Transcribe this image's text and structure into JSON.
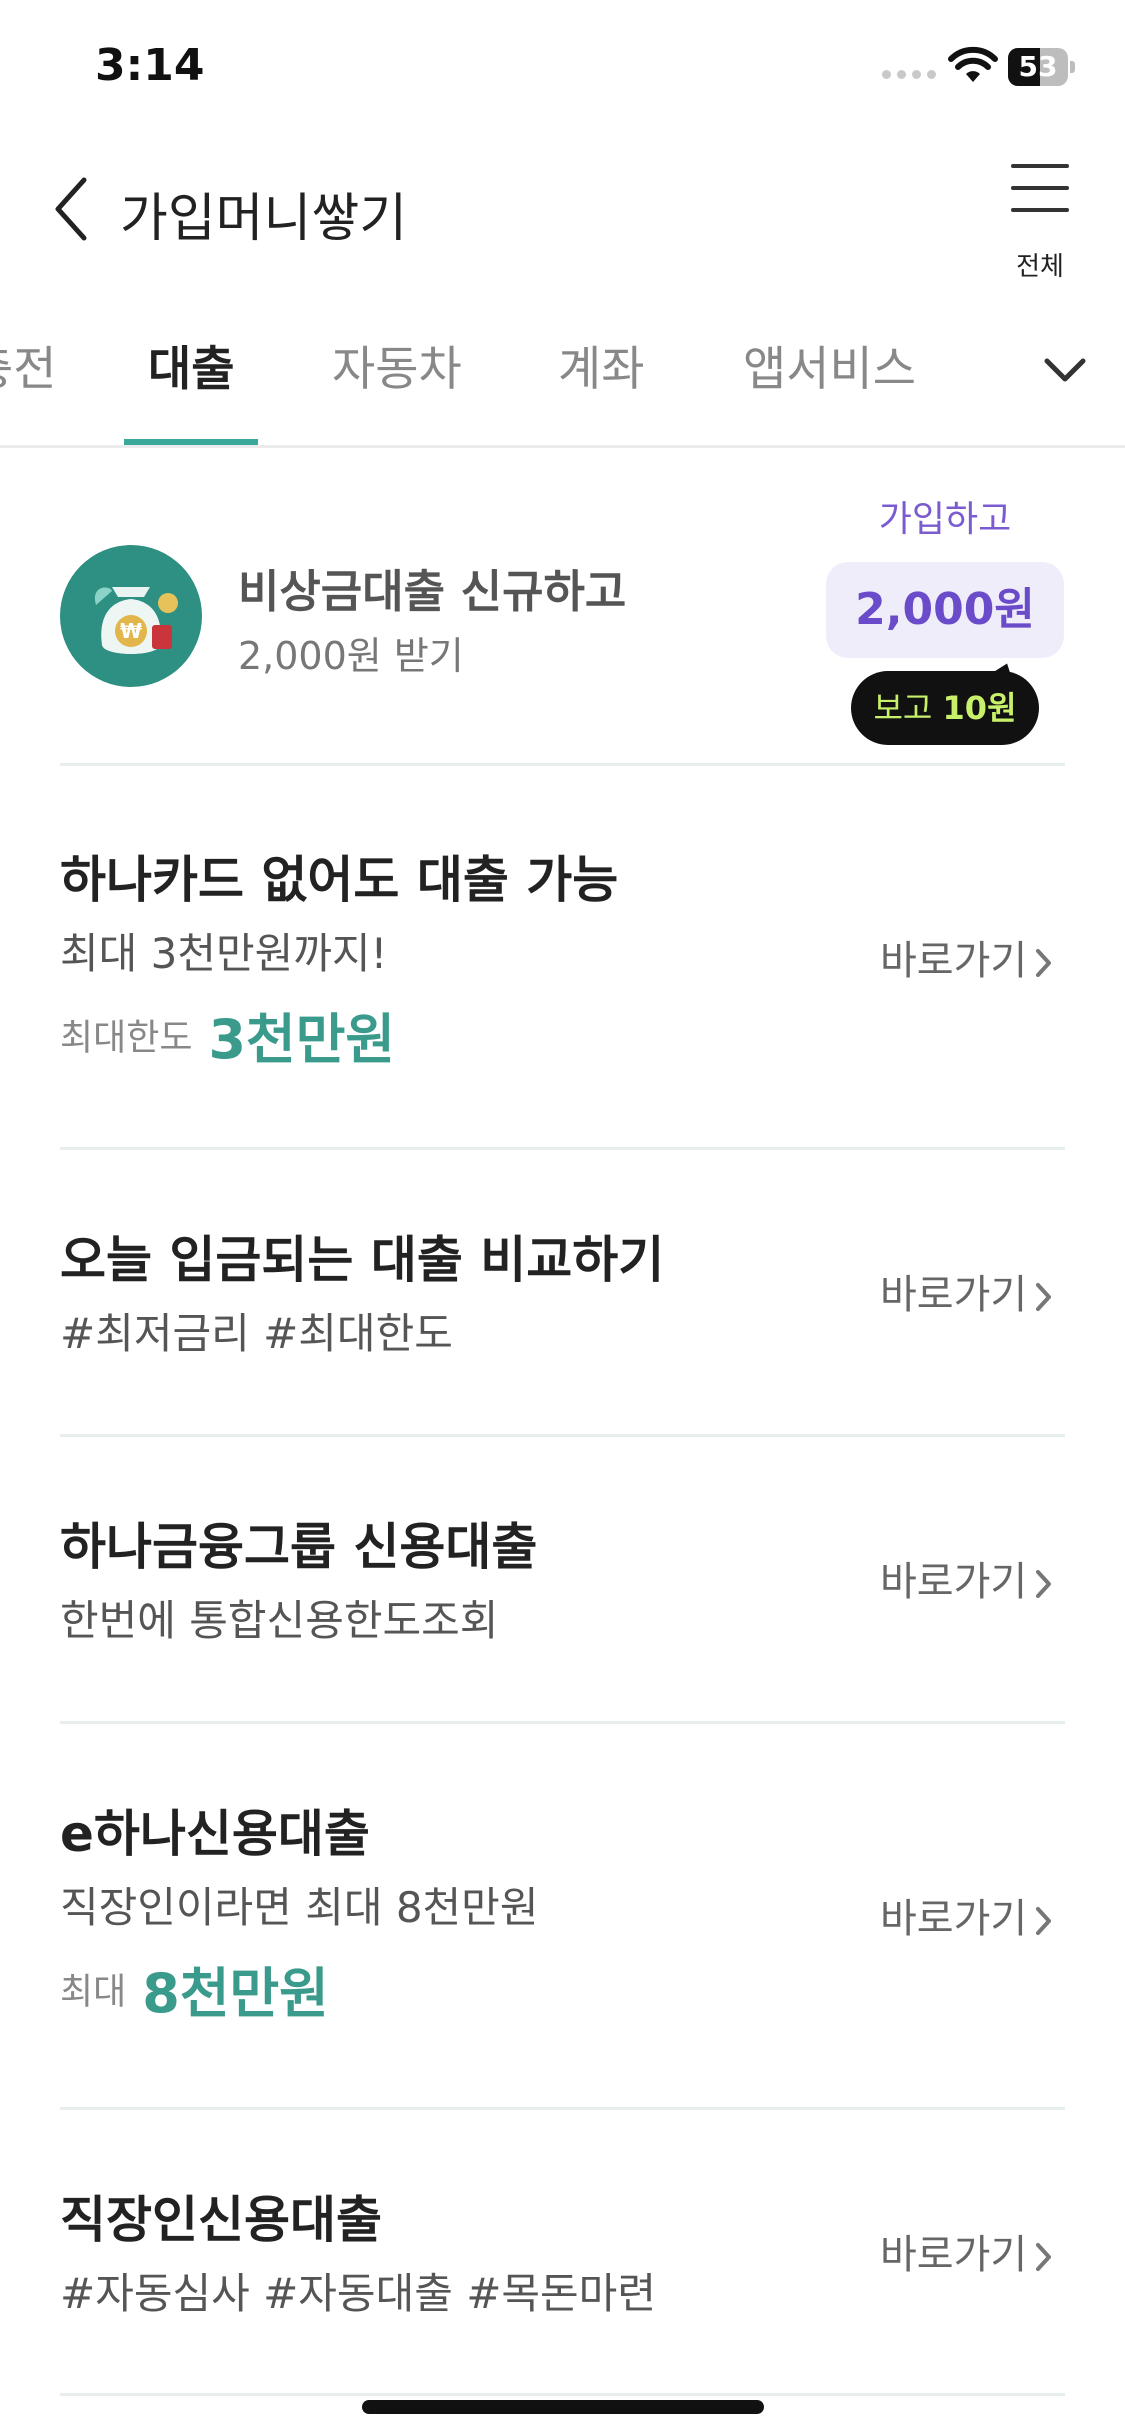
{
  "status_bar": {
    "time": "3:14",
    "battery": "53"
  },
  "header": {
    "title": "가입머니쌓기",
    "menu_label": "전체"
  },
  "tabs": [
    {
      "label": "충전",
      "active": false
    },
    {
      "label": "대출",
      "active": true
    },
    {
      "label": "자동차",
      "active": false
    },
    {
      "label": "계좌",
      "active": false
    },
    {
      "label": "앱서비스",
      "active": false
    }
  ],
  "promo": {
    "title": "비상금대출 신규하고",
    "subtitle": "2,000원 받기",
    "reward_label": "가입하고",
    "reward_amount": "2,000원",
    "bubble_prefix": "보고",
    "bubble_amount": "10원"
  },
  "items": [
    {
      "title": "하나카드 없어도 대출 가능",
      "subtitle": "최대 3천만원까지!",
      "limit_label": "최대한도",
      "limit_value": "3천만원",
      "action": "바로가기"
    },
    {
      "title": "오늘 입금되는 대출 비교하기",
      "subtitle": "#최저금리 #최대한도",
      "action": "바로가기"
    },
    {
      "title": "하나금융그룹 신용대출",
      "subtitle": "한번에 통합신용한도조회",
      "action": "바로가기"
    },
    {
      "title": "e하나신용대출",
      "subtitle": "직장인이라면 최대 8천만원",
      "limit_label": "최대",
      "limit_value": "8천만원",
      "action": "바로가기"
    },
    {
      "title": "직장인신용대출",
      "subtitle": "#자동심사 #자동대출 #목돈마련",
      "action": "바로가기"
    }
  ],
  "colors": {
    "accent": "#3aa89a",
    "promo_purple": "#6a4bc9",
    "bubble_green": "#c8f06a"
  }
}
